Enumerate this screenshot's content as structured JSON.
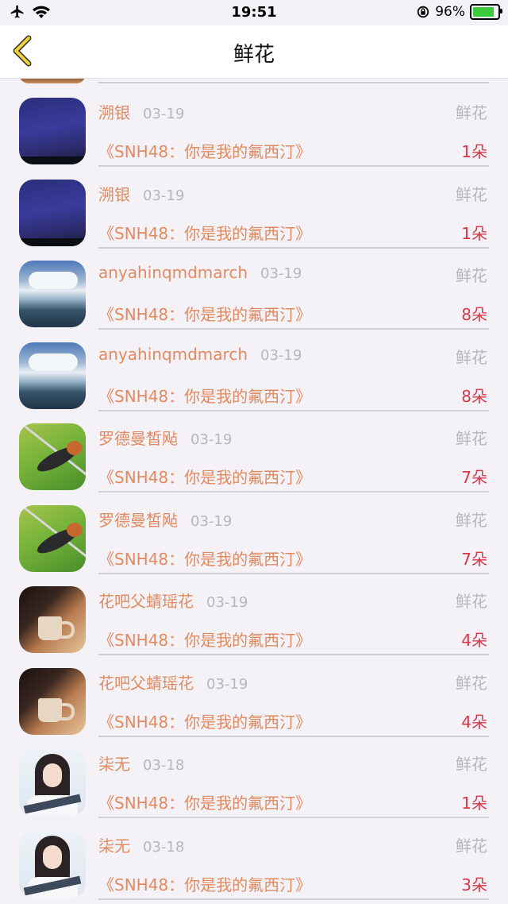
{
  "status_bar": {
    "time": "19:51",
    "battery": "96%"
  },
  "nav": {
    "title": "鲜花"
  },
  "rows": [
    {
      "name": "溯银",
      "date": "03-19",
      "tag": "鲜花",
      "program": "《SNH48：你是我的氟西汀》",
      "count": "1朵",
      "avatar": "night"
    },
    {
      "name": "溯银",
      "date": "03-19",
      "tag": "鲜花",
      "program": "《SNH48：你是我的氟西汀》",
      "count": "1朵",
      "avatar": "night"
    },
    {
      "name": "anyahinqmdmarch",
      "date": "03-19",
      "tag": "鲜花",
      "program": "《SNH48：你是我的氟西汀》",
      "count": "8朵",
      "avatar": "sea"
    },
    {
      "name": "anyahinqmdmarch",
      "date": "03-19",
      "tag": "鲜花",
      "program": "《SNH48：你是我的氟西汀》",
      "count": "8朵",
      "avatar": "sea"
    },
    {
      "name": "罗德曼皙飐",
      "date": "03-19",
      "tag": "鲜花",
      "program": "《SNH48：你是我的氟西汀》",
      "count": "7朵",
      "avatar": "bird"
    },
    {
      "name": "罗德曼皙飐",
      "date": "03-19",
      "tag": "鲜花",
      "program": "《SNH48：你是我的氟西汀》",
      "count": "7朵",
      "avatar": "bird"
    },
    {
      "name": "花吧父蜻瑶花",
      "date": "03-19",
      "tag": "鲜花",
      "program": "《SNH48：你是我的氟西汀》",
      "count": "4朵",
      "avatar": "cup"
    },
    {
      "name": "花吧父蜻瑶花",
      "date": "03-19",
      "tag": "鲜花",
      "program": "《SNH48：你是我的氟西汀》",
      "count": "4朵",
      "avatar": "cup"
    },
    {
      "name": "柒无",
      "date": "03-18",
      "tag": "鲜花",
      "program": "《SNH48：你是我的氟西汀》",
      "count": "1朵",
      "avatar": "girl"
    },
    {
      "name": "柒无",
      "date": "03-18",
      "tag": "鲜花",
      "program": "《SNH48：你是我的氟西汀》",
      "count": "3朵",
      "avatar": "girl"
    }
  ],
  "colors": {
    "name": "#e08b61",
    "count": "#d8374a",
    "muted": "#b8b6ba",
    "back_icon": "#f1d23b"
  }
}
